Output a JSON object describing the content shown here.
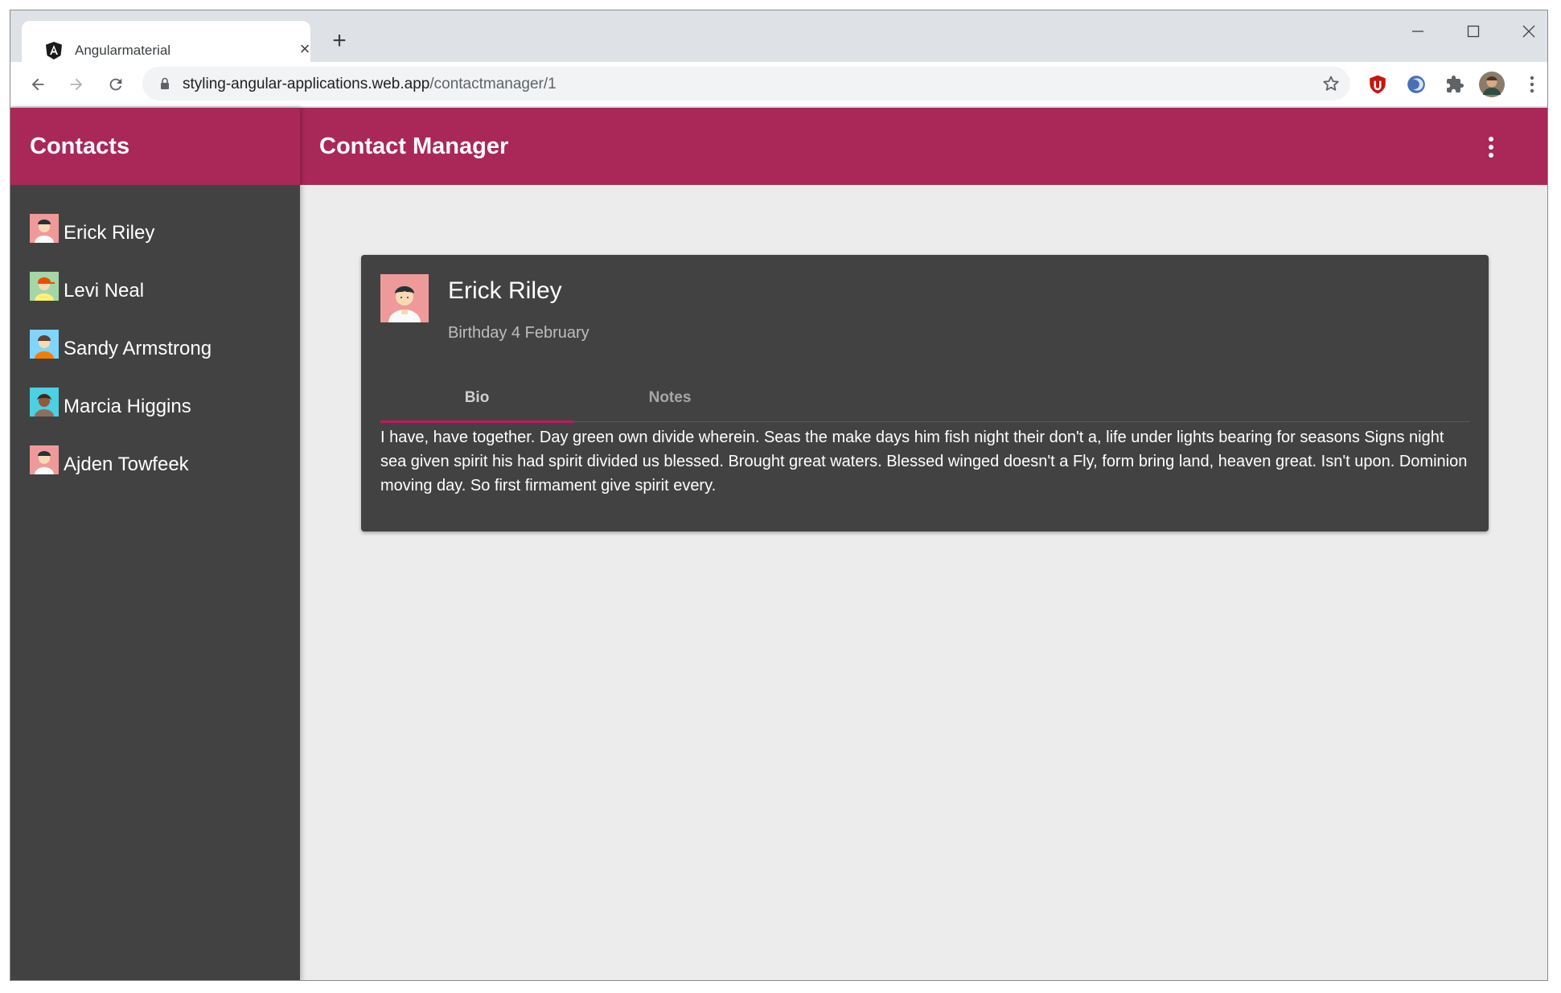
{
  "browser": {
    "tab_title": "Angularmaterial",
    "url_host": "styling-angular-applications.web.app",
    "url_path": "/contactmanager/1"
  },
  "sidenav": {
    "title": "Contacts",
    "contacts": [
      {
        "name": "Erick Riley"
      },
      {
        "name": "Levi Neal"
      },
      {
        "name": "Sandy Armstrong"
      },
      {
        "name": "Marcia Higgins"
      },
      {
        "name": "Ajden Towfeek"
      }
    ]
  },
  "header": {
    "title": "Contact Manager"
  },
  "card": {
    "name": "Erick Riley",
    "subtitle": "Birthday 4 February",
    "tabs": [
      {
        "label": "Bio",
        "active": true
      },
      {
        "label": "Notes",
        "active": false
      }
    ],
    "bio": "I have, have together. Day green own divide wherein. Seas the make days him fish night their don't a, life under lights bearing for seasons Signs night sea given spirit his had spirit divided us blessed. Brought great waters. Blessed winged doesn't a Fly, form bring land, heaven great. Isn't upon. Dominion moving day. So first firmament give spirit every."
  },
  "colors": {
    "primary": "#a92858",
    "sidenav_bg": "#424242",
    "accent_ink": "#c2185b",
    "content_bg": "#ececec"
  }
}
